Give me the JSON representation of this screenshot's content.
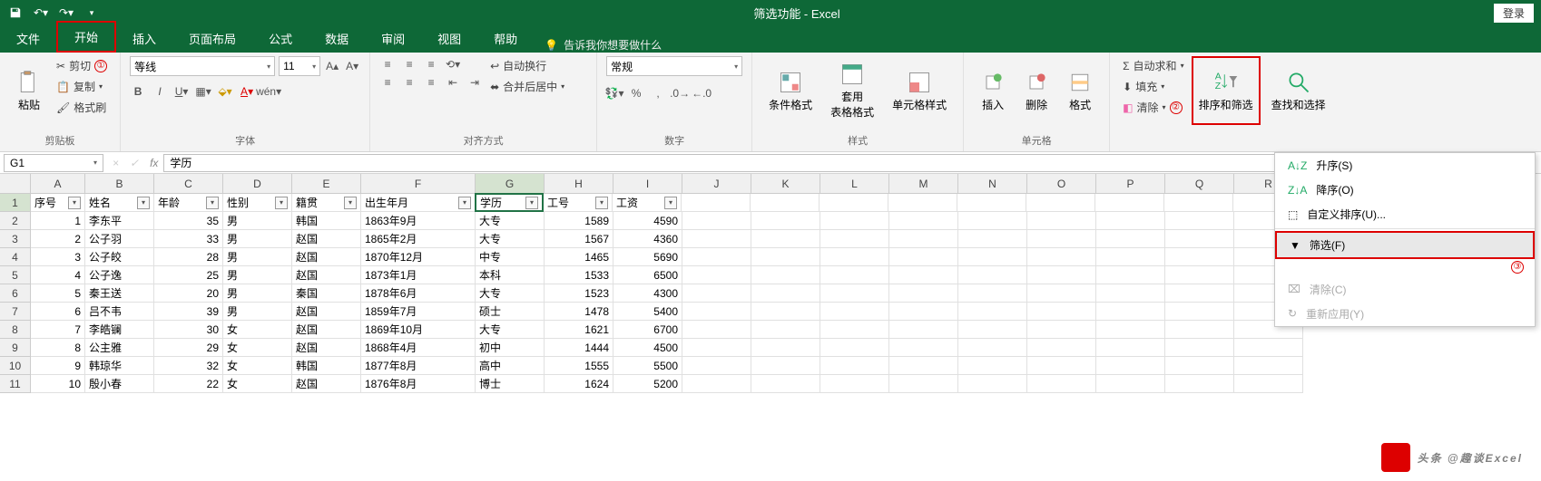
{
  "title": "筛选功能 - Excel",
  "login": "登录",
  "tabs": [
    "文件",
    "开始",
    "插入",
    "页面布局",
    "公式",
    "数据",
    "审阅",
    "视图",
    "帮助"
  ],
  "tellme": "告诉我你想要做什么",
  "clipboard": {
    "paste": "粘贴",
    "cut": "剪切",
    "copy": "复制",
    "painter": "格式刷",
    "label": "剪贴板"
  },
  "font": {
    "name": "等线",
    "size": "11",
    "label": "字体"
  },
  "align": {
    "wrap": "自动换行",
    "merge": "合并后居中",
    "label": "对齐方式"
  },
  "number": {
    "fmt": "常规",
    "label": "数字"
  },
  "styles": {
    "cond": "条件格式",
    "table": "套用\n表格格式",
    "cell": "单元格样式",
    "label": "样式"
  },
  "cells": {
    "insert": "插入",
    "delete": "删除",
    "format": "格式",
    "label": "单元格"
  },
  "editing": {
    "sum": "自动求和",
    "fill": "填充",
    "clear": "清除",
    "sort": "排序和筛选",
    "find": "查找和选择"
  },
  "annot": {
    "1": "①",
    "2": "②",
    "3": "③"
  },
  "namebox": "G1",
  "formula": "学历",
  "cols": [
    "A",
    "B",
    "C",
    "D",
    "E",
    "F",
    "G",
    "H",
    "I",
    "J",
    "K",
    "L",
    "M",
    "N",
    "O",
    "P",
    "Q",
    "R"
  ],
  "headers": [
    "序号",
    "姓名",
    "年龄",
    "性别",
    "籍贯",
    "出生年月",
    "学历",
    "工号",
    "工资"
  ],
  "rows": [
    {
      "n": 1,
      "name": "李东平",
      "age": 35,
      "sex": "男",
      "place": "韩国",
      "birth": "1863年9月",
      "edu": "大专",
      "id": 1589,
      "sal": 4590
    },
    {
      "n": 2,
      "name": "公子羽",
      "age": 33,
      "sex": "男",
      "place": "赵国",
      "birth": "1865年2月",
      "edu": "大专",
      "id": 1567,
      "sal": 4360
    },
    {
      "n": 3,
      "name": "公子皎",
      "age": 28,
      "sex": "男",
      "place": "赵国",
      "birth": "1870年12月",
      "edu": "中专",
      "id": 1465,
      "sal": 5690
    },
    {
      "n": 4,
      "name": "公子逸",
      "age": 25,
      "sex": "男",
      "place": "赵国",
      "birth": "1873年1月",
      "edu": "本科",
      "id": 1533,
      "sal": 6500
    },
    {
      "n": 5,
      "name": "秦王送",
      "age": 20,
      "sex": "男",
      "place": "秦国",
      "birth": "1878年6月",
      "edu": "大专",
      "id": 1523,
      "sal": 4300
    },
    {
      "n": 6,
      "name": "吕不韦",
      "age": 39,
      "sex": "男",
      "place": "赵国",
      "birth": "1859年7月",
      "edu": "硕士",
      "id": 1478,
      "sal": 5400
    },
    {
      "n": 7,
      "name": "李皓镧",
      "age": 30,
      "sex": "女",
      "place": "赵国",
      "birth": "1869年10月",
      "edu": "大专",
      "id": 1621,
      "sal": 6700
    },
    {
      "n": 8,
      "name": "公主雅",
      "age": 29,
      "sex": "女",
      "place": "赵国",
      "birth": "1868年4月",
      "edu": "初中",
      "id": 1444,
      "sal": 4500
    },
    {
      "n": 9,
      "name": "韩琼华",
      "age": 32,
      "sex": "女",
      "place": "韩国",
      "birth": "1877年8月",
      "edu": "高中",
      "id": 1555,
      "sal": 5500
    },
    {
      "n": 10,
      "name": "殷小春",
      "age": 22,
      "sex": "女",
      "place": "赵国",
      "birth": "1876年8月",
      "edu": "博士",
      "id": 1624,
      "sal": 5200
    }
  ],
  "menu": {
    "asc": "升序(S)",
    "desc": "降序(O)",
    "custom": "自定义排序(U)...",
    "filter": "筛选(F)",
    "clear": "清除(C)",
    "reapply": "重新应用(Y)"
  },
  "watermark": "头条 @趣谈Excel"
}
